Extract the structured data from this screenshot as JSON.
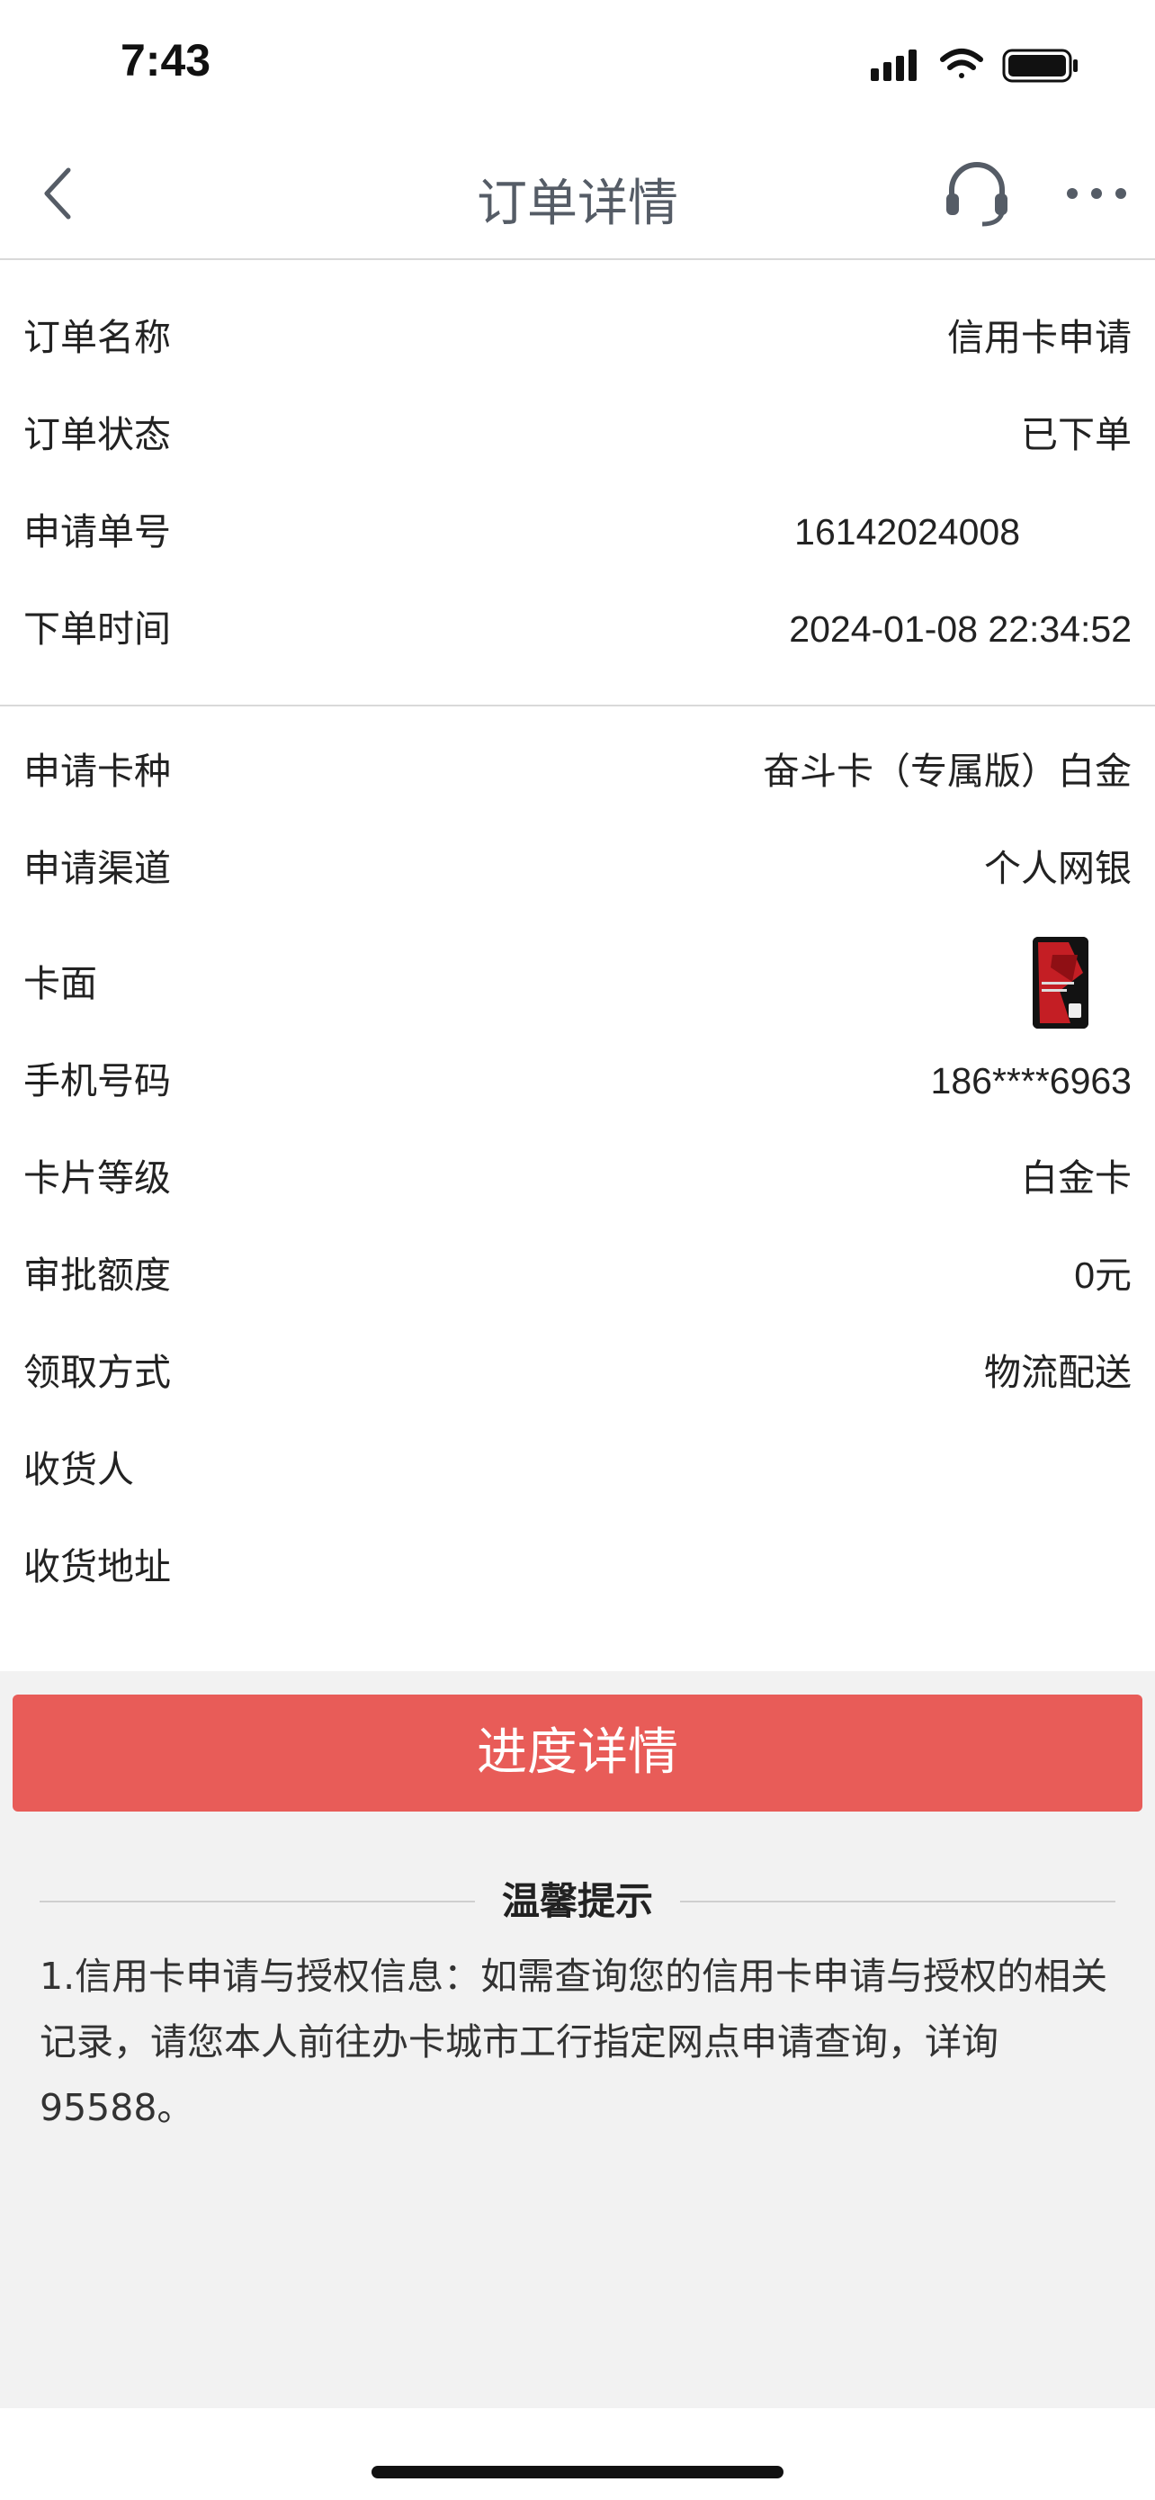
{
  "status": {
    "time": "7:43"
  },
  "nav": {
    "title": "订单详情",
    "back_icon": "chevron-left-icon",
    "service_icon": "headset-icon",
    "more_icon": "more-dots-icon"
  },
  "order": [
    {
      "label": "订单名称",
      "value": "信用卡申请"
    },
    {
      "label": "订单状态",
      "value": "已下单"
    },
    {
      "label": "申请单号",
      "value": "16142024008"
    },
    {
      "label": "下单时间",
      "value": "2024-01-08 22:34:52"
    }
  ],
  "details": [
    {
      "label": "申请卡种",
      "value": "奋斗卡（专属版）白金"
    },
    {
      "label": "申请渠道",
      "value": "个人网银"
    },
    {
      "label": "卡面",
      "value": ""
    },
    {
      "label": "手机号码",
      "value": "186****6963"
    },
    {
      "label": "卡片等级",
      "value": "白金卡"
    },
    {
      "label": "审批额度",
      "value": "0元"
    },
    {
      "label": "领取方式",
      "value": "物流配送"
    },
    {
      "label": "收货人",
      "value": ""
    },
    {
      "label": "收货地址",
      "value": ""
    }
  ],
  "progress_button": "进度详情",
  "tips": {
    "title": "温馨提示",
    "text": "1.信用卡申请与授权信息：如需查询您的信用卡申请与授权的相关记录，请您本人前往办卡城市工行指定网点申请查询，详询95588。"
  },
  "colors": {
    "accent": "#e85c58",
    "background": "#f2f2f2",
    "title": "#555c66"
  }
}
